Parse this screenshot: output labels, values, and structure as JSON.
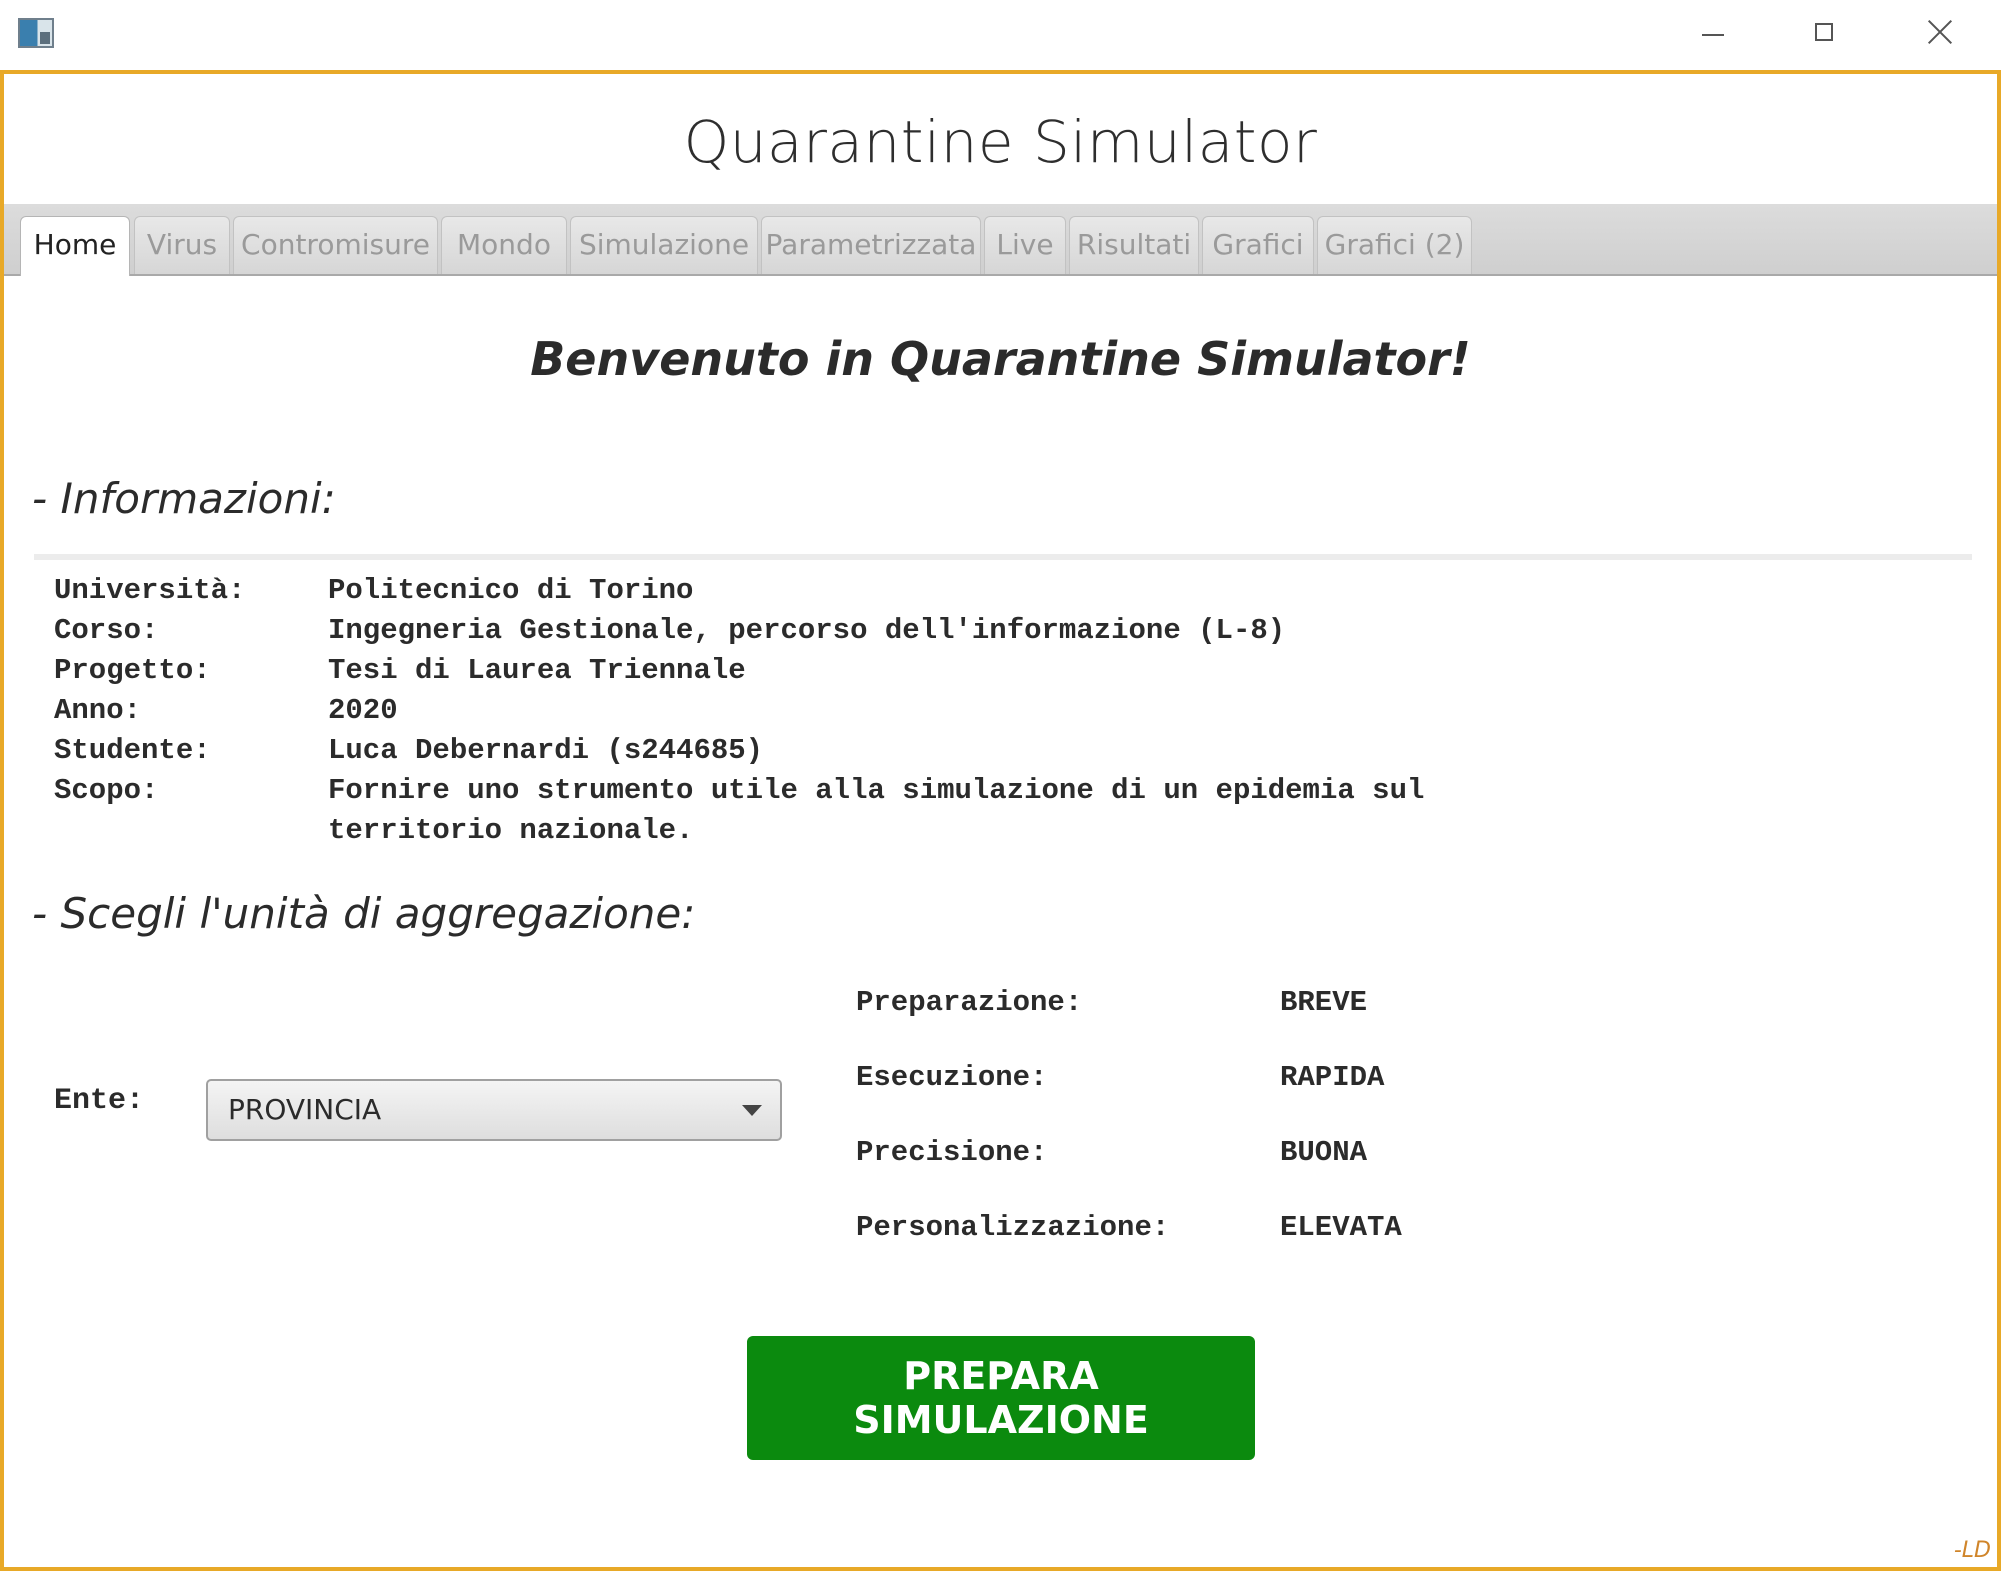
{
  "window": {
    "title": "Quarantine Simulator",
    "frame_color": "#e8a928"
  },
  "tabs": [
    {
      "label": "Home",
      "active": true
    },
    {
      "label": "Virus",
      "active": false
    },
    {
      "label": "Contromisure",
      "active": false
    },
    {
      "label": "Mondo",
      "active": false
    },
    {
      "label": "Simulazione",
      "active": false
    },
    {
      "label": "Parametrizzata",
      "active": false
    },
    {
      "label": "Live",
      "active": false
    },
    {
      "label": "Risultati",
      "active": false
    },
    {
      "label": "Grafici",
      "active": false
    },
    {
      "label": "Grafici (2)",
      "active": false
    }
  ],
  "home": {
    "welcome": "Benvenuto in Quarantine Simulator!",
    "info_heading": "- Informazioni:",
    "info": [
      {
        "key": "Università:",
        "value": "Politecnico di Torino"
      },
      {
        "key": "Corso:",
        "value": "Ingegneria Gestionale, percorso dell'informazione (L-8)"
      },
      {
        "key": "Progetto:",
        "value": "Tesi di Laurea Triennale"
      },
      {
        "key": "Anno:",
        "value": "2020"
      },
      {
        "key": "Studente:",
        "value": "Luca Debernardi (s244685)"
      },
      {
        "key": "Scopo:",
        "value": "Fornire uno strumento utile alla simulazione di un epidemia sul"
      },
      {
        "key": "",
        "value": "territorio nazionale."
      }
    ],
    "aggregation_heading": "- Scegli l'unità di aggregazione:",
    "ente_label": "Ente:",
    "ente_selected": "PROVINCIA",
    "stats": [
      {
        "key": "Preparazione:",
        "value": "BREVE"
      },
      {
        "key": "Esecuzione:",
        "value": "RAPIDA"
      },
      {
        "key": "Precisione:",
        "value": "BUONA"
      },
      {
        "key": "Personalizzazione:",
        "value": "ELEVATA"
      }
    ],
    "prepare_button": "PREPARA SIMULAZIONE",
    "prepare_button_color": "#0b8a0e",
    "signature": "-LD"
  }
}
